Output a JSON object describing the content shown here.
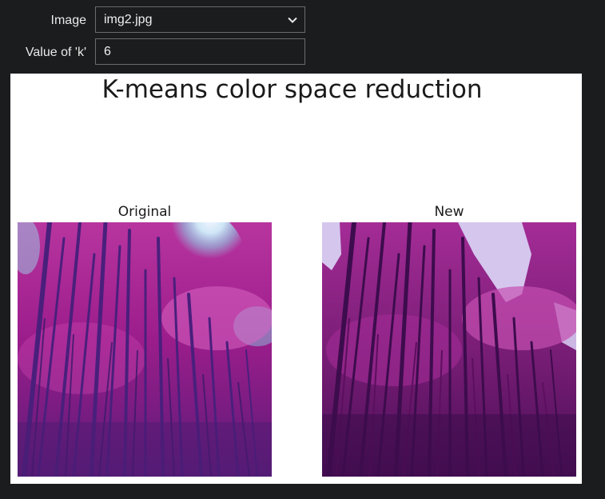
{
  "form": {
    "image": {
      "label": "Image",
      "selected": "img2.jpg"
    },
    "k": {
      "label": "Value of 'k'",
      "value": "6"
    }
  },
  "figure": {
    "title": "K-means color space reduction",
    "panels": {
      "original": {
        "title": "Original"
      },
      "new": {
        "title": "New"
      }
    }
  },
  "colors": {
    "page_background": "#1b1c1e",
    "original_palette": [
      "#9a1a8e",
      "#6f1d80",
      "#4a1f7c",
      "#c23fb0",
      "#e07ad0",
      "#dfe9f6",
      "#7fd3e8"
    ],
    "new_palette": [
      "#5c0f5e",
      "#7e1f7a",
      "#a42c96",
      "#c44eb1",
      "#3d0c4d",
      "#d5c6ee"
    ]
  }
}
